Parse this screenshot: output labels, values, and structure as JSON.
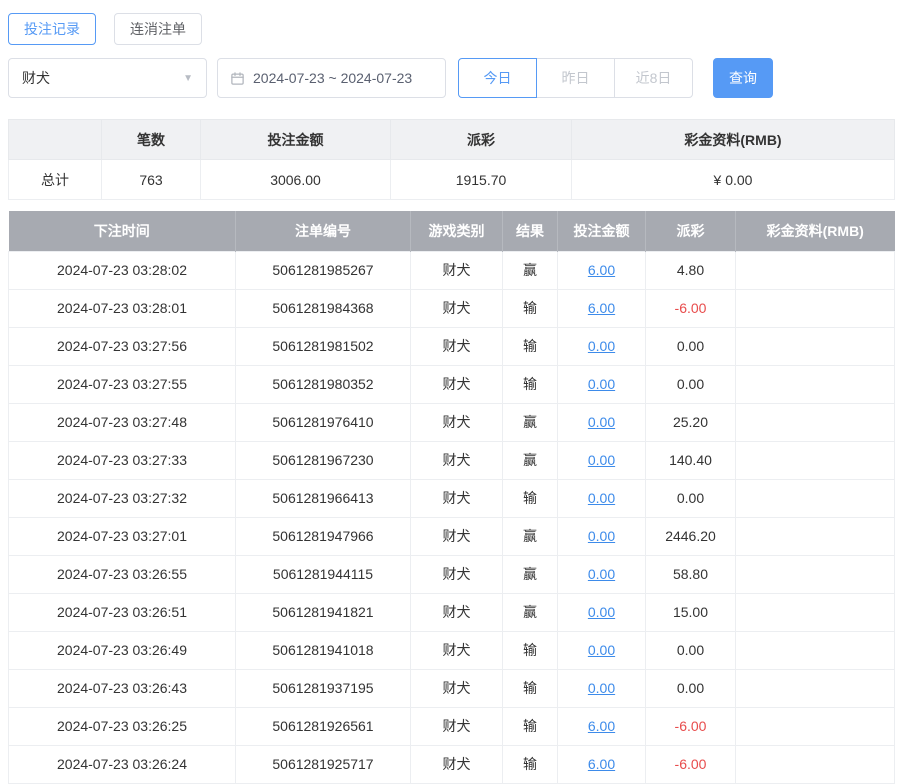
{
  "colors": {
    "accent": "#569af5",
    "link": "#3d8bea",
    "negative": "#e84c4c",
    "table_header_bg": "#a7aab1"
  },
  "tabs": [
    {
      "label": "投注记录",
      "active": true
    },
    {
      "label": "连消注单",
      "active": false
    }
  ],
  "filters": {
    "game_select_value": "财犬",
    "date_range": "2024-07-23 ~ 2024-07-23",
    "quick_buttons": [
      {
        "label": "今日",
        "active": true
      },
      {
        "label": "昨日",
        "active": false
      },
      {
        "label": "近8日",
        "active": false
      }
    ],
    "search_label": "查询"
  },
  "summary": {
    "headers": [
      "",
      "笔数",
      "投注金额",
      "派彩",
      "彩金资料(RMB)"
    ],
    "total_label": "总计",
    "count": "763",
    "bet_amount": "3006.00",
    "payout": "1915.70",
    "bonus": "¥ 0.00"
  },
  "table": {
    "headers": [
      "下注时间",
      "注单编号",
      "游戏类别",
      "结果",
      "投注金额",
      "派彩",
      "彩金资料(RMB)"
    ],
    "rows": [
      {
        "time": "2024-07-23 03:28:02",
        "order_id": "5061281985267",
        "game": "财犬",
        "result": "赢",
        "bet": "6.00",
        "payout": "4.80",
        "bonus": ""
      },
      {
        "time": "2024-07-23 03:28:01",
        "order_id": "5061281984368",
        "game": "财犬",
        "result": "输",
        "bet": "6.00",
        "payout": "-6.00",
        "bonus": ""
      },
      {
        "time": "2024-07-23 03:27:56",
        "order_id": "5061281981502",
        "game": "财犬",
        "result": "输",
        "bet": "0.00",
        "payout": "0.00",
        "bonus": ""
      },
      {
        "time": "2024-07-23 03:27:55",
        "order_id": "5061281980352",
        "game": "财犬",
        "result": "输",
        "bet": "0.00",
        "payout": "0.00",
        "bonus": ""
      },
      {
        "time": "2024-07-23 03:27:48",
        "order_id": "5061281976410",
        "game": "财犬",
        "result": "赢",
        "bet": "0.00",
        "payout": "25.20",
        "bonus": ""
      },
      {
        "time": "2024-07-23 03:27:33",
        "order_id": "5061281967230",
        "game": "财犬",
        "result": "赢",
        "bet": "0.00",
        "payout": "140.40",
        "bonus": ""
      },
      {
        "time": "2024-07-23 03:27:32",
        "order_id": "5061281966413",
        "game": "财犬",
        "result": "输",
        "bet": "0.00",
        "payout": "0.00",
        "bonus": ""
      },
      {
        "time": "2024-07-23 03:27:01",
        "order_id": "5061281947966",
        "game": "财犬",
        "result": "赢",
        "bet": "0.00",
        "payout": "2446.20",
        "bonus": ""
      },
      {
        "time": "2024-07-23 03:26:55",
        "order_id": "5061281944115",
        "game": "财犬",
        "result": "赢",
        "bet": "0.00",
        "payout": "58.80",
        "bonus": ""
      },
      {
        "time": "2024-07-23 03:26:51",
        "order_id": "5061281941821",
        "game": "财犬",
        "result": "赢",
        "bet": "0.00",
        "payout": "15.00",
        "bonus": ""
      },
      {
        "time": "2024-07-23 03:26:49",
        "order_id": "5061281941018",
        "game": "财犬",
        "result": "输",
        "bet": "0.00",
        "payout": "0.00",
        "bonus": ""
      },
      {
        "time": "2024-07-23 03:26:43",
        "order_id": "5061281937195",
        "game": "财犬",
        "result": "输",
        "bet": "0.00",
        "payout": "0.00",
        "bonus": ""
      },
      {
        "time": "2024-07-23 03:26:25",
        "order_id": "5061281926561",
        "game": "财犬",
        "result": "输",
        "bet": "6.00",
        "payout": "-6.00",
        "bonus": ""
      },
      {
        "time": "2024-07-23 03:26:24",
        "order_id": "5061281925717",
        "game": "财犬",
        "result": "输",
        "bet": "6.00",
        "payout": "-6.00",
        "bonus": ""
      }
    ]
  }
}
